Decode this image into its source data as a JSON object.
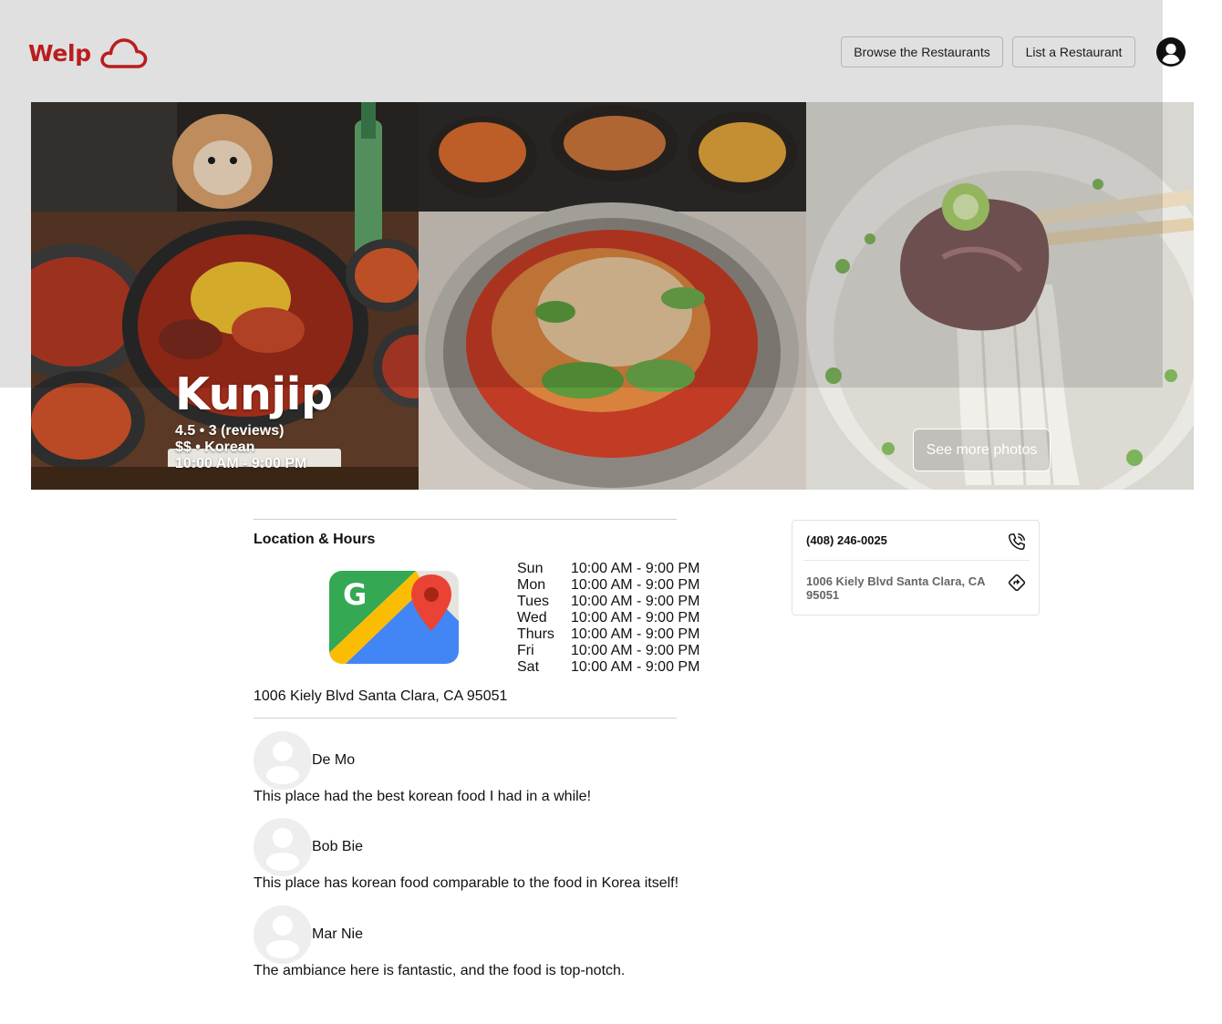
{
  "brand": {
    "name": "Welp",
    "color": "#d32323",
    "logo_icon": "cloud-icon"
  },
  "nav": {
    "browse_label": "Browse the Restaurants",
    "list_label": "List a Restaurant",
    "account_icon": "user-circle-icon"
  },
  "hero": {
    "photos": [
      "kunjip-stew-photo",
      "cold-noodles-photo",
      "noodle-soup-photo"
    ],
    "name": "Kunjip",
    "rating_line": "4.5 • 3 (reviews)",
    "price_category_line": "$$ • Korean",
    "hours_line": "10:00 AM - 9:00 PM",
    "see_more_label": "See more photos"
  },
  "location": {
    "title": "Location & Hours",
    "map_icon": "google-maps-icon",
    "address": "1006 Kiely Blvd Santa Clara, CA 95051",
    "hours": [
      {
        "day": "Sun",
        "time": "10:00 AM - 9:00 PM"
      },
      {
        "day": "Mon",
        "time": "10:00 AM - 9:00 PM"
      },
      {
        "day": "Tues",
        "time": "10:00 AM - 9:00 PM"
      },
      {
        "day": "Wed",
        "time": "10:00 AM - 9:00 PM"
      },
      {
        "day": "Thurs",
        "time": "10:00 AM - 9:00 PM"
      },
      {
        "day": "Fri",
        "time": "10:00 AM - 9:00 PM"
      },
      {
        "day": "Sat",
        "time": "10:00 AM - 9:00 PM"
      }
    ]
  },
  "reviews": [
    {
      "name": "De Mo",
      "text": "This place had the best korean food I had in a while!"
    },
    {
      "name": "Bob Bie",
      "text": "This place has korean food comparable to the food in Korea itself!"
    },
    {
      "name": "Mar Nie",
      "text": "The ambiance here is fantastic, and the food is top-notch."
    }
  ],
  "contact": {
    "phone": "(408) 246-0025",
    "phone_icon": "phone-icon",
    "address": "1006 Kiely Blvd Santa Clara, CA 95051",
    "directions_icon": "directions-icon"
  }
}
